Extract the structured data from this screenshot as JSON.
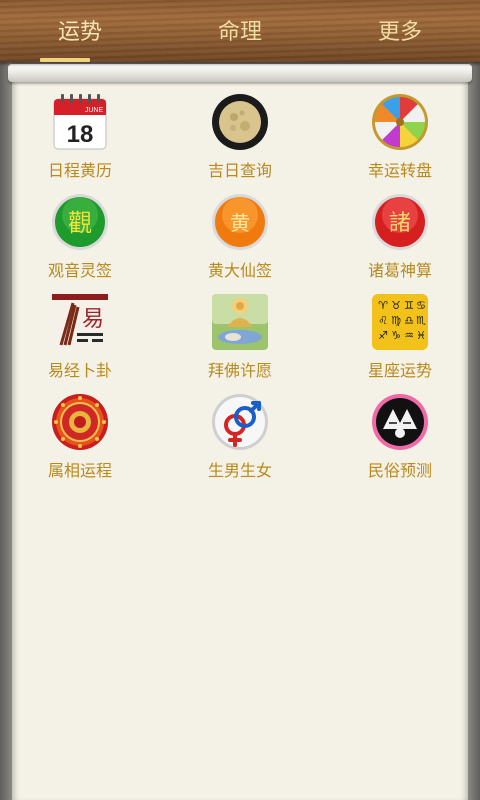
{
  "tabs": [
    {
      "label": "运势",
      "active": true
    },
    {
      "label": "命理",
      "active": false
    },
    {
      "label": "更多",
      "active": false
    }
  ],
  "items": [
    {
      "label": "日程黄历",
      "icon": "calendar-icon",
      "calendar_month": "JUNE",
      "calendar_day": "18"
    },
    {
      "label": "吉日查询",
      "icon": "moon-icon"
    },
    {
      "label": "幸运转盘",
      "icon": "wheel-icon"
    },
    {
      "label": "观音灵签",
      "icon": "guanyin-icon",
      "glyph": "觀"
    },
    {
      "label": "黄大仙签",
      "icon": "huangdaxian-icon",
      "glyph": "黄"
    },
    {
      "label": "诸葛神算",
      "icon": "zhuge-icon",
      "glyph": "諸"
    },
    {
      "label": "易经卜卦",
      "icon": "yijing-icon",
      "glyph": "易"
    },
    {
      "label": "拜佛许愿",
      "icon": "buddha-icon"
    },
    {
      "label": "星座运势",
      "icon": "zodiac-icon"
    },
    {
      "label": "属相运程",
      "icon": "chinese-zodiac-icon"
    },
    {
      "label": "生男生女",
      "icon": "gender-icon"
    },
    {
      "label": "民俗预测",
      "icon": "folk-icon"
    }
  ],
  "colors": {
    "label_text": "#b88a1e",
    "tab_text": "#f1dca2",
    "tab_indicator": "#f2d37b"
  }
}
